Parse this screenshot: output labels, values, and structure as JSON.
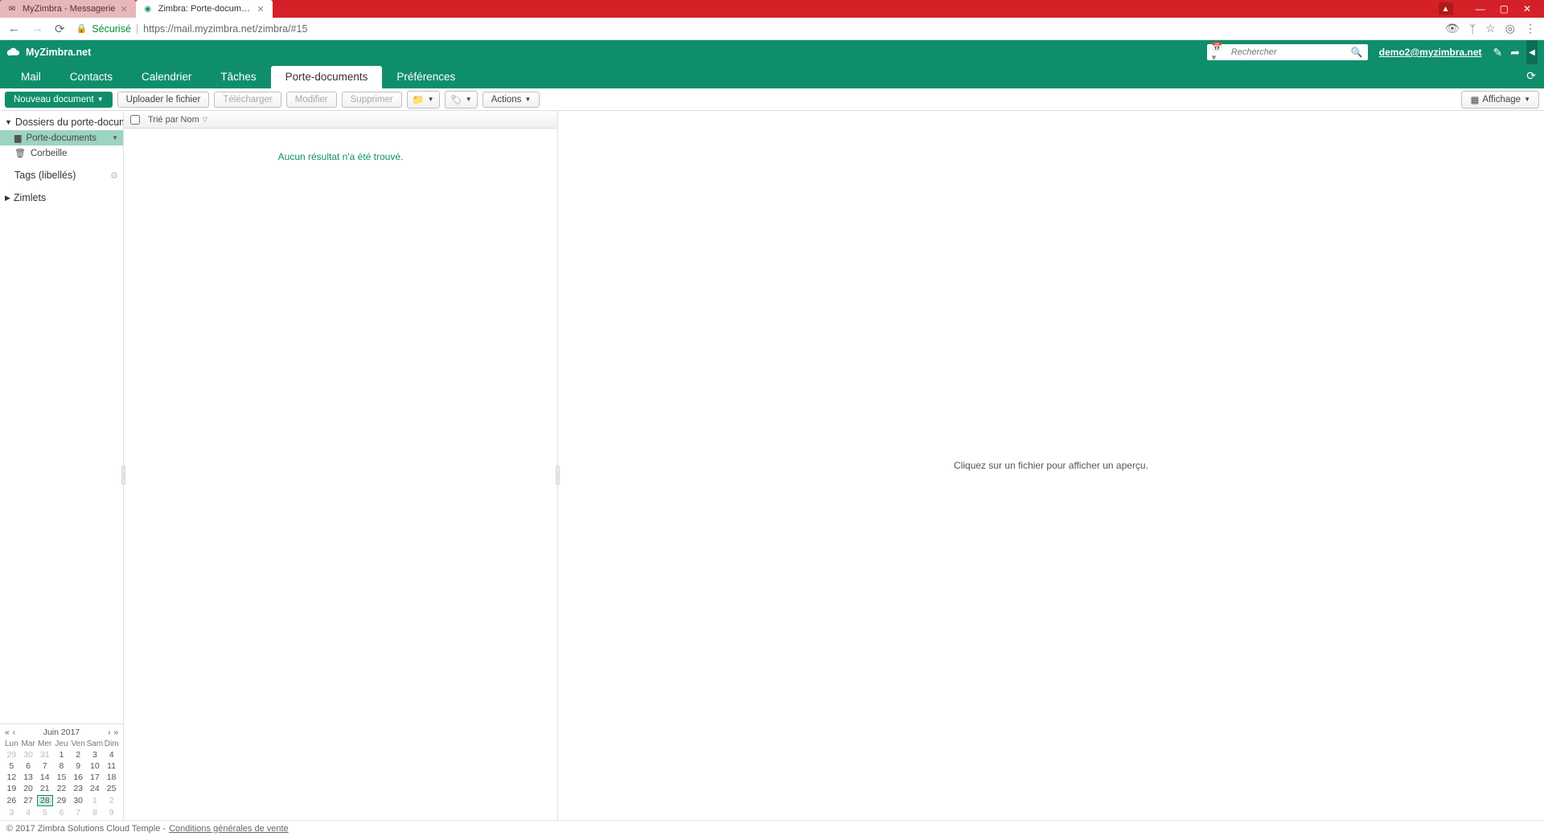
{
  "browser": {
    "tabs": [
      {
        "title": "MyZimbra - Messagerie",
        "active": false
      },
      {
        "title": "Zimbra: Porte-document",
        "active": true
      }
    ],
    "secure_label": "Sécurisé",
    "url": "https://mail.myzimbra.net/zimbra/#15"
  },
  "header": {
    "brand": "MyZimbra.net",
    "search_placeholder": "Rechercher",
    "account": "demo2@myzimbra.net"
  },
  "nav": {
    "tabs": [
      "Mail",
      "Contacts",
      "Calendrier",
      "Tâches",
      "Porte-documents",
      "Préférences"
    ],
    "active": "Porte-documents"
  },
  "toolbar": {
    "new_doc": "Nouveau document",
    "upload": "Uploader le fichier",
    "download": "Télécharger",
    "edit": "Modifier",
    "delete": "Supprimer",
    "actions": "Actions",
    "display": "Affichage"
  },
  "sidebar": {
    "folders_head": "Dossiers du porte-docum",
    "briefcase": "Porte-documents",
    "trash": "Corbeille",
    "tags_head": "Tags (libellés)",
    "zimlets_head": "Zimlets"
  },
  "calendar": {
    "title": "Juin 2017",
    "dow": [
      "Lun",
      "Mar",
      "Mer",
      "Jeu",
      "Ven",
      "Sam",
      "Dim"
    ],
    "weeks": [
      [
        {
          "d": "29",
          "o": true
        },
        {
          "d": "30",
          "o": true
        },
        {
          "d": "31",
          "o": true
        },
        {
          "d": "1"
        },
        {
          "d": "2"
        },
        {
          "d": "3"
        },
        {
          "d": "4"
        }
      ],
      [
        {
          "d": "5"
        },
        {
          "d": "6"
        },
        {
          "d": "7"
        },
        {
          "d": "8"
        },
        {
          "d": "9"
        },
        {
          "d": "10"
        },
        {
          "d": "11"
        }
      ],
      [
        {
          "d": "12"
        },
        {
          "d": "13"
        },
        {
          "d": "14"
        },
        {
          "d": "15"
        },
        {
          "d": "16"
        },
        {
          "d": "17"
        },
        {
          "d": "18"
        }
      ],
      [
        {
          "d": "19"
        },
        {
          "d": "20"
        },
        {
          "d": "21"
        },
        {
          "d": "22"
        },
        {
          "d": "23"
        },
        {
          "d": "24"
        },
        {
          "d": "25"
        }
      ],
      [
        {
          "d": "26"
        },
        {
          "d": "27"
        },
        {
          "d": "28",
          "today": true
        },
        {
          "d": "29"
        },
        {
          "d": "30"
        },
        {
          "d": "1",
          "o": true
        },
        {
          "d": "2",
          "o": true
        }
      ],
      [
        {
          "d": "3",
          "o": true
        },
        {
          "d": "4",
          "o": true
        },
        {
          "d": "5",
          "o": true
        },
        {
          "d": "6",
          "o": true
        },
        {
          "d": "7",
          "o": true
        },
        {
          "d": "8",
          "o": true
        },
        {
          "d": "9",
          "o": true
        }
      ]
    ]
  },
  "list": {
    "sort_label": "Trié par Nom",
    "empty": "Aucun résultat n'a été trouvé."
  },
  "preview": {
    "hint": "Cliquez sur un fichier pour afficher un aperçu."
  },
  "footer": {
    "copyright": "© 2017 Zimbra Solutions Cloud Temple - ",
    "terms": "Conditions générales de vente"
  }
}
